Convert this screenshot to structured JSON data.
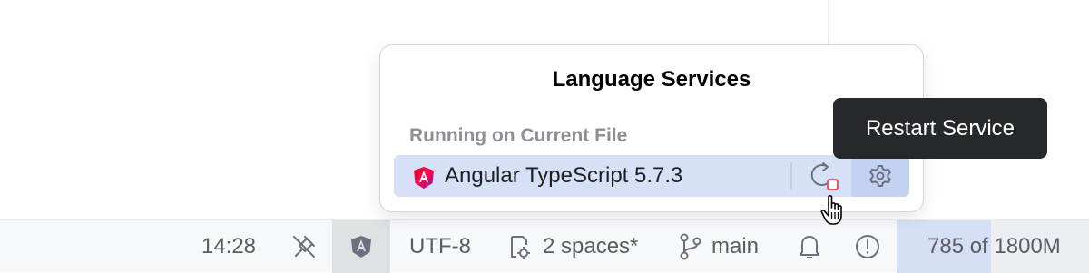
{
  "popup": {
    "title": "Language Services",
    "section_label": "Running on Current File",
    "service": {
      "name": "Angular TypeScript 5.7.3",
      "icon": "angular-icon",
      "actions": [
        "restart-icon",
        "gear-icon"
      ]
    }
  },
  "tooltip": {
    "text": "Restart Service"
  },
  "statusbar": {
    "time": "14:28",
    "encoding": "UTF-8",
    "indent": "2 spaces*",
    "branch": "main",
    "memory": "785 of 1800M"
  },
  "colors": {
    "accent": "#3574f0",
    "selection": "#d6e1f7",
    "tooltip_bg": "#27282c",
    "stop_badge": "#e55765",
    "angular_red": "#dd0031",
    "angular_purple": "#c3002f"
  }
}
